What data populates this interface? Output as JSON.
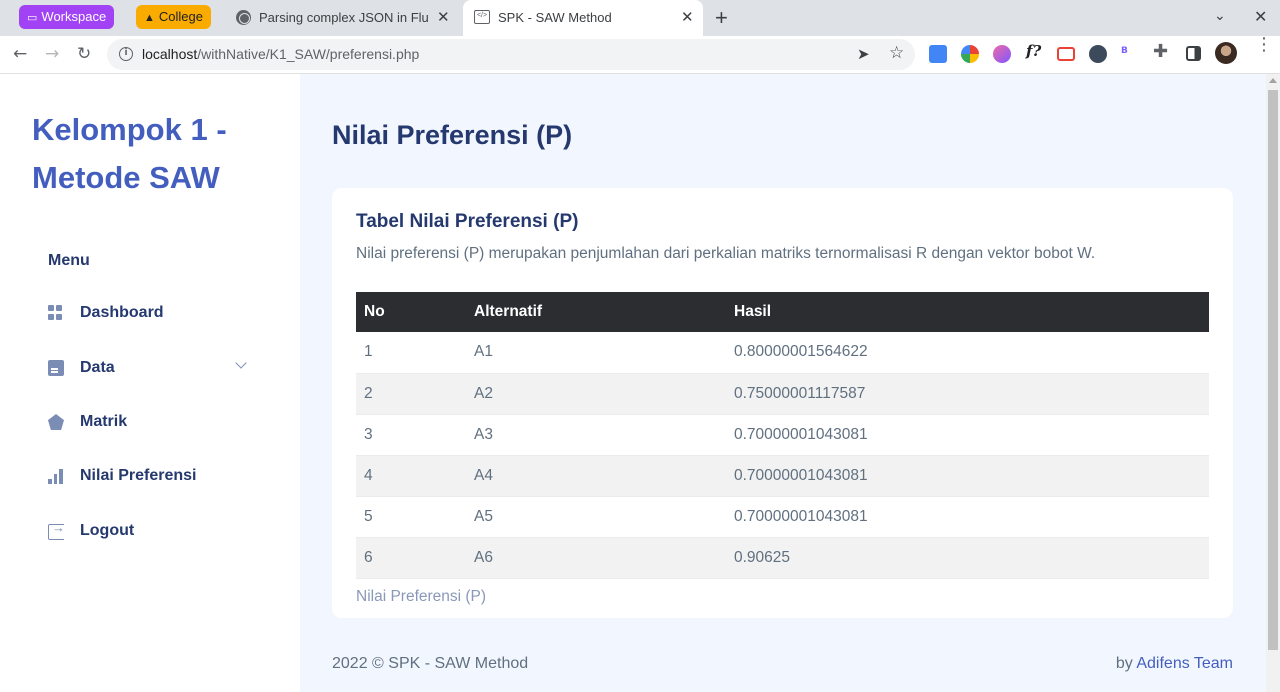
{
  "browser": {
    "tab_groups": [
      {
        "label": "Workspace",
        "color": "#a142f4"
      },
      {
        "label": "College",
        "color": "#f9ab00"
      }
    ],
    "tabs": [
      {
        "title": "Parsing complex JSON in Flutter",
        "icon": "globe-icon"
      },
      {
        "title": "SPK - SAW Method",
        "icon": "code-page-icon",
        "active": true
      }
    ],
    "url_host": "localhost",
    "url_path": "/withNative/K1_SAW/preferensi.php"
  },
  "sidebar": {
    "brand": "Kelompok 1 - Metode SAW",
    "menu_title": "Menu",
    "items": [
      {
        "label": "Dashboard",
        "icon": "grid-icon"
      },
      {
        "label": "Data",
        "icon": "file-icon",
        "has_submenu": true
      },
      {
        "label": "Matrik",
        "icon": "pentagon-icon"
      },
      {
        "label": "Nilai Preferensi",
        "icon": "bar-chart-icon",
        "active": true
      },
      {
        "label": "Logout",
        "icon": "logout-icon"
      }
    ]
  },
  "main": {
    "page_title": "Nilai Preferensi (P)",
    "card_title": "Tabel Nilai Preferensi (P)",
    "card_subtitle": "Nilai preferensi (P) merupakan penjumlahan dari perkalian matriks ternormalisasi R dengan vektor bobot W.",
    "table": {
      "headers": [
        "No",
        "Alternatif",
        "Hasil"
      ],
      "rows": [
        [
          "1",
          "A1",
          "0.80000001564622"
        ],
        [
          "2",
          "A2",
          "0.75000001117587"
        ],
        [
          "3",
          "A3",
          "0.70000001043081"
        ],
        [
          "4",
          "A4",
          "0.70000001043081"
        ],
        [
          "5",
          "A5",
          "0.70000001043081"
        ],
        [
          "6",
          "A6",
          "0.90625"
        ]
      ],
      "caption": "Nilai Preferensi (P)"
    }
  },
  "footer": {
    "copyright": "2022 © SPK - SAW Method",
    "by_label": "by",
    "team": "Adifens Team"
  },
  "colors": {
    "accent": "#435ebe",
    "heading": "#25396f",
    "page_bg": "#f2f7ff"
  }
}
